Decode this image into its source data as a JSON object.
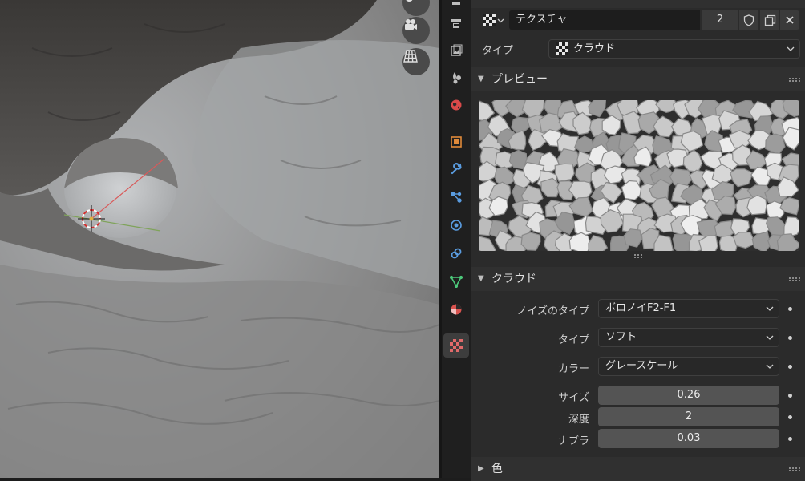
{
  "texture": {
    "name": "テクスチャ",
    "users": "2"
  },
  "type_row": {
    "label": "タイプ",
    "value": "クラウド"
  },
  "preview_panel": {
    "title": "プレビュー"
  },
  "clouds_panel": {
    "title": "クラウド",
    "noise_type_label": "ノイズのタイプ",
    "noise_type_value": "ボロノイF2-F1",
    "type_label": "タイプ",
    "type_value": "ソフト",
    "color_label": "カラー",
    "color_value": "グレースケール",
    "size_label": "サイズ",
    "size_value": "0.26",
    "depth_label": "深度",
    "depth_value": "2",
    "nabla_label": "ナブラ",
    "nabla_value": "0.03"
  },
  "color_panel": {
    "title": "色"
  },
  "viewport_buttons": [
    "hand-icon",
    "camera-icon",
    "grid-icon"
  ],
  "tab_icons": [
    "render-icon",
    "output-icon",
    "view-layer-icon",
    "scene-icon",
    "world-icon",
    "object-icon",
    "modifier-icon",
    "particles-icon",
    "physics-icon",
    "constraints-icon",
    "data-icon",
    "material-icon",
    "texture-icon"
  ],
  "colors": {
    "panel_bg": "#2b2b2b",
    "header_bg": "#303030",
    "field_bg": "#545454",
    "active_tab": "#3d3d3d"
  }
}
